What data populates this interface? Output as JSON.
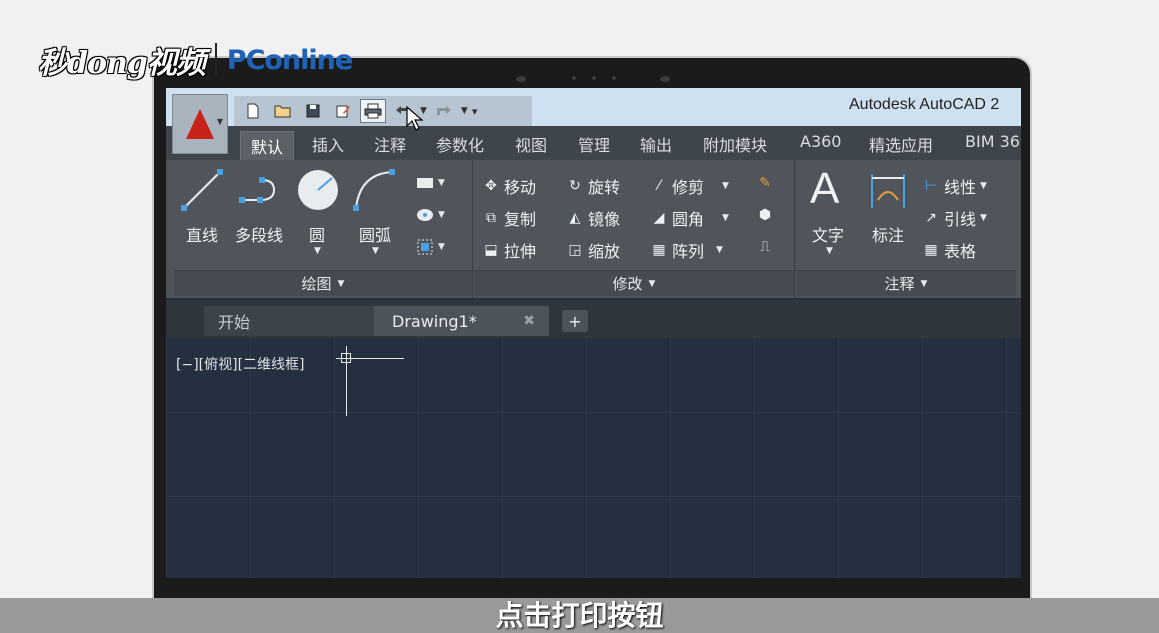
{
  "watermark": {
    "brand_a": "秒dong视频",
    "brand_b": "PConline"
  },
  "app": {
    "title": "Autodesk AutoCAD 2"
  },
  "qat": {
    "items": [
      "new-icon",
      "open-icon",
      "save-icon",
      "save-as-icon",
      "print-icon",
      "undo-icon",
      "redo-icon",
      "customize-icon"
    ]
  },
  "ribbon_tabs": [
    "默认",
    "插入",
    "注释",
    "参数化",
    "视图",
    "管理",
    "输出",
    "附加模块",
    "A360",
    "精选应用",
    "BIM 36"
  ],
  "draw_panel": {
    "tools": [
      "直线",
      "多段线",
      "圆",
      "圆弧"
    ],
    "footer": "绘图"
  },
  "modify_panel": {
    "rows": [
      [
        "移动",
        "旋转",
        "修剪"
      ],
      [
        "复制",
        "镜像",
        "圆角"
      ],
      [
        "拉伸",
        "缩放",
        "阵列"
      ]
    ],
    "footer": "修改"
  },
  "annotation_panel": {
    "text_tool": "文字",
    "dim_tool": "标注",
    "small": [
      "线性",
      "引线",
      "表格"
    ],
    "footer": "注释"
  },
  "doc_tabs": {
    "start": "开始",
    "active": "Drawing1*",
    "plus": "+"
  },
  "viewport": {
    "label": "[−][俯视][二维线框]"
  },
  "subtitle": "点击打印按钮",
  "colors": {
    "accent": "#c8231b",
    "ribbon": "#50555c",
    "canvas": "#243040"
  }
}
